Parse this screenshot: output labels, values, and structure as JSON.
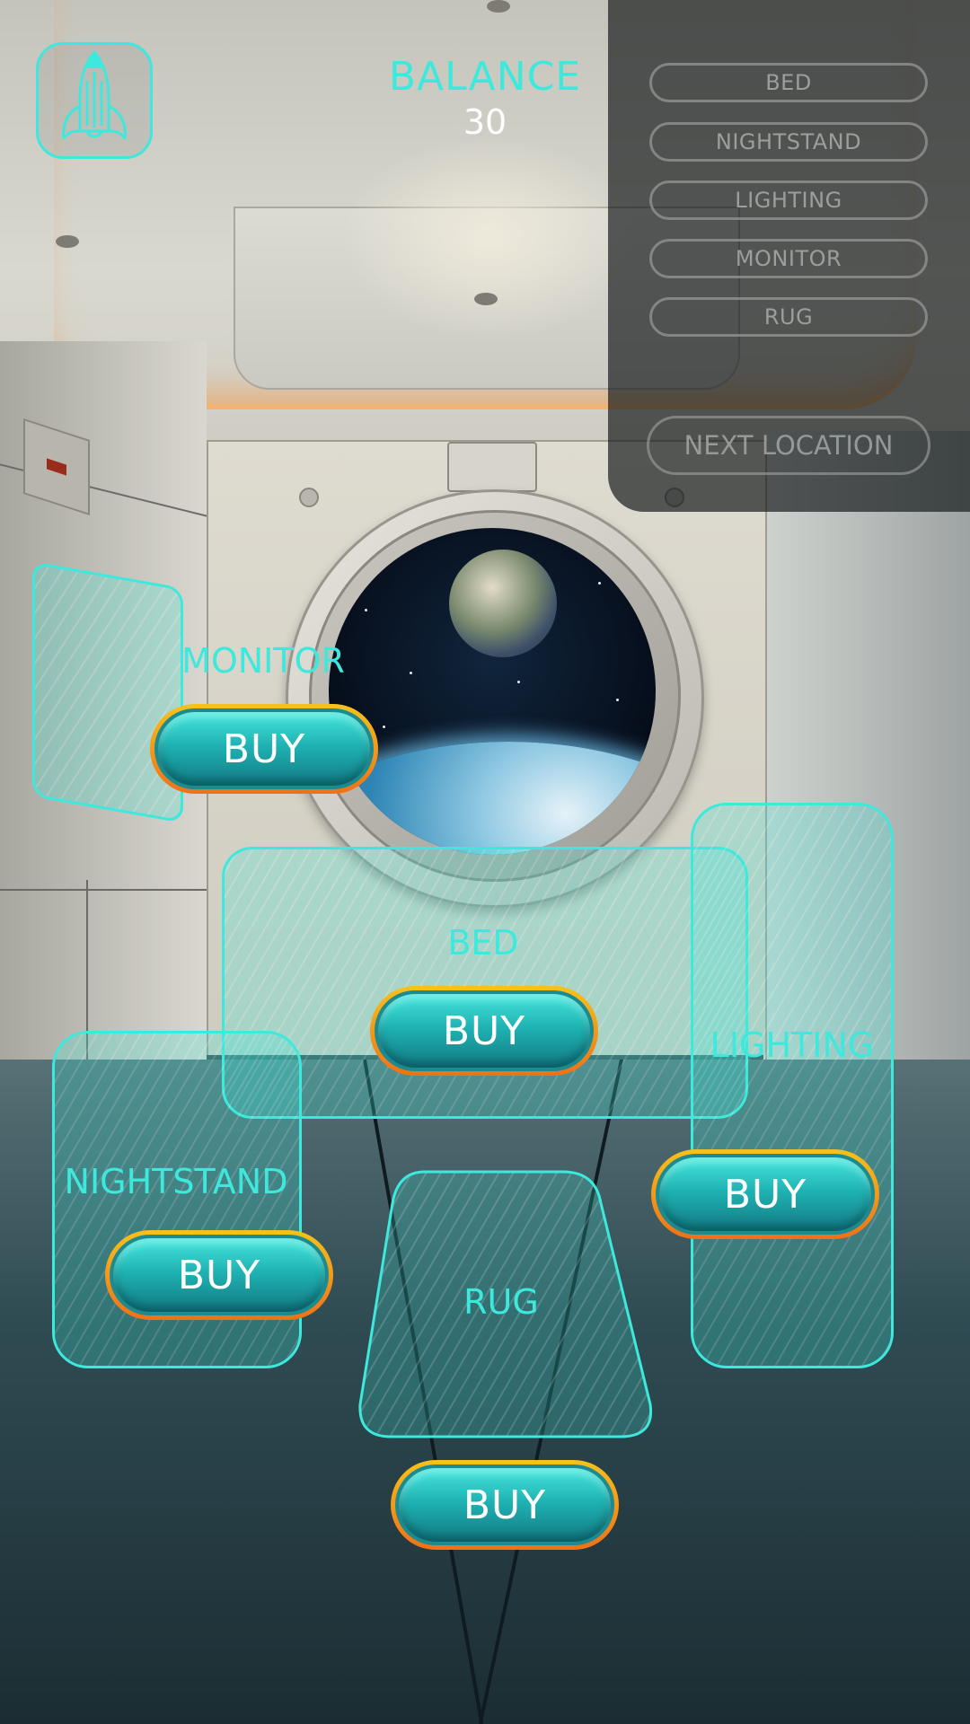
{
  "hud": {
    "balance_label": "BALANCE",
    "balance_value": "30",
    "logo_icon": "rocket-icon",
    "accent_color": "#3de9dc"
  },
  "menu": {
    "items": [
      {
        "label": "BED"
      },
      {
        "label": "NIGHTSTAND"
      },
      {
        "label": "LIGHTING"
      },
      {
        "label": "MONITOR"
      },
      {
        "label": "RUG"
      }
    ],
    "next_label": "NEXT LOCATION"
  },
  "zones": {
    "monitor": {
      "label": "MONITOR",
      "buy_label": "BUY"
    },
    "bed": {
      "label": "BED",
      "buy_label": "BUY"
    },
    "lighting": {
      "label": "LIGHTING",
      "buy_label": "BUY"
    },
    "nightstand": {
      "label": "NIGHTSTAND",
      "buy_label": "BUY"
    },
    "rug": {
      "label": "RUG",
      "buy_label": "BUY"
    }
  },
  "colors": {
    "buy_button_fill": "#1fb3b3",
    "buy_button_outline_top": "#f7c21a",
    "buy_button_outline_bottom": "#f07018"
  }
}
